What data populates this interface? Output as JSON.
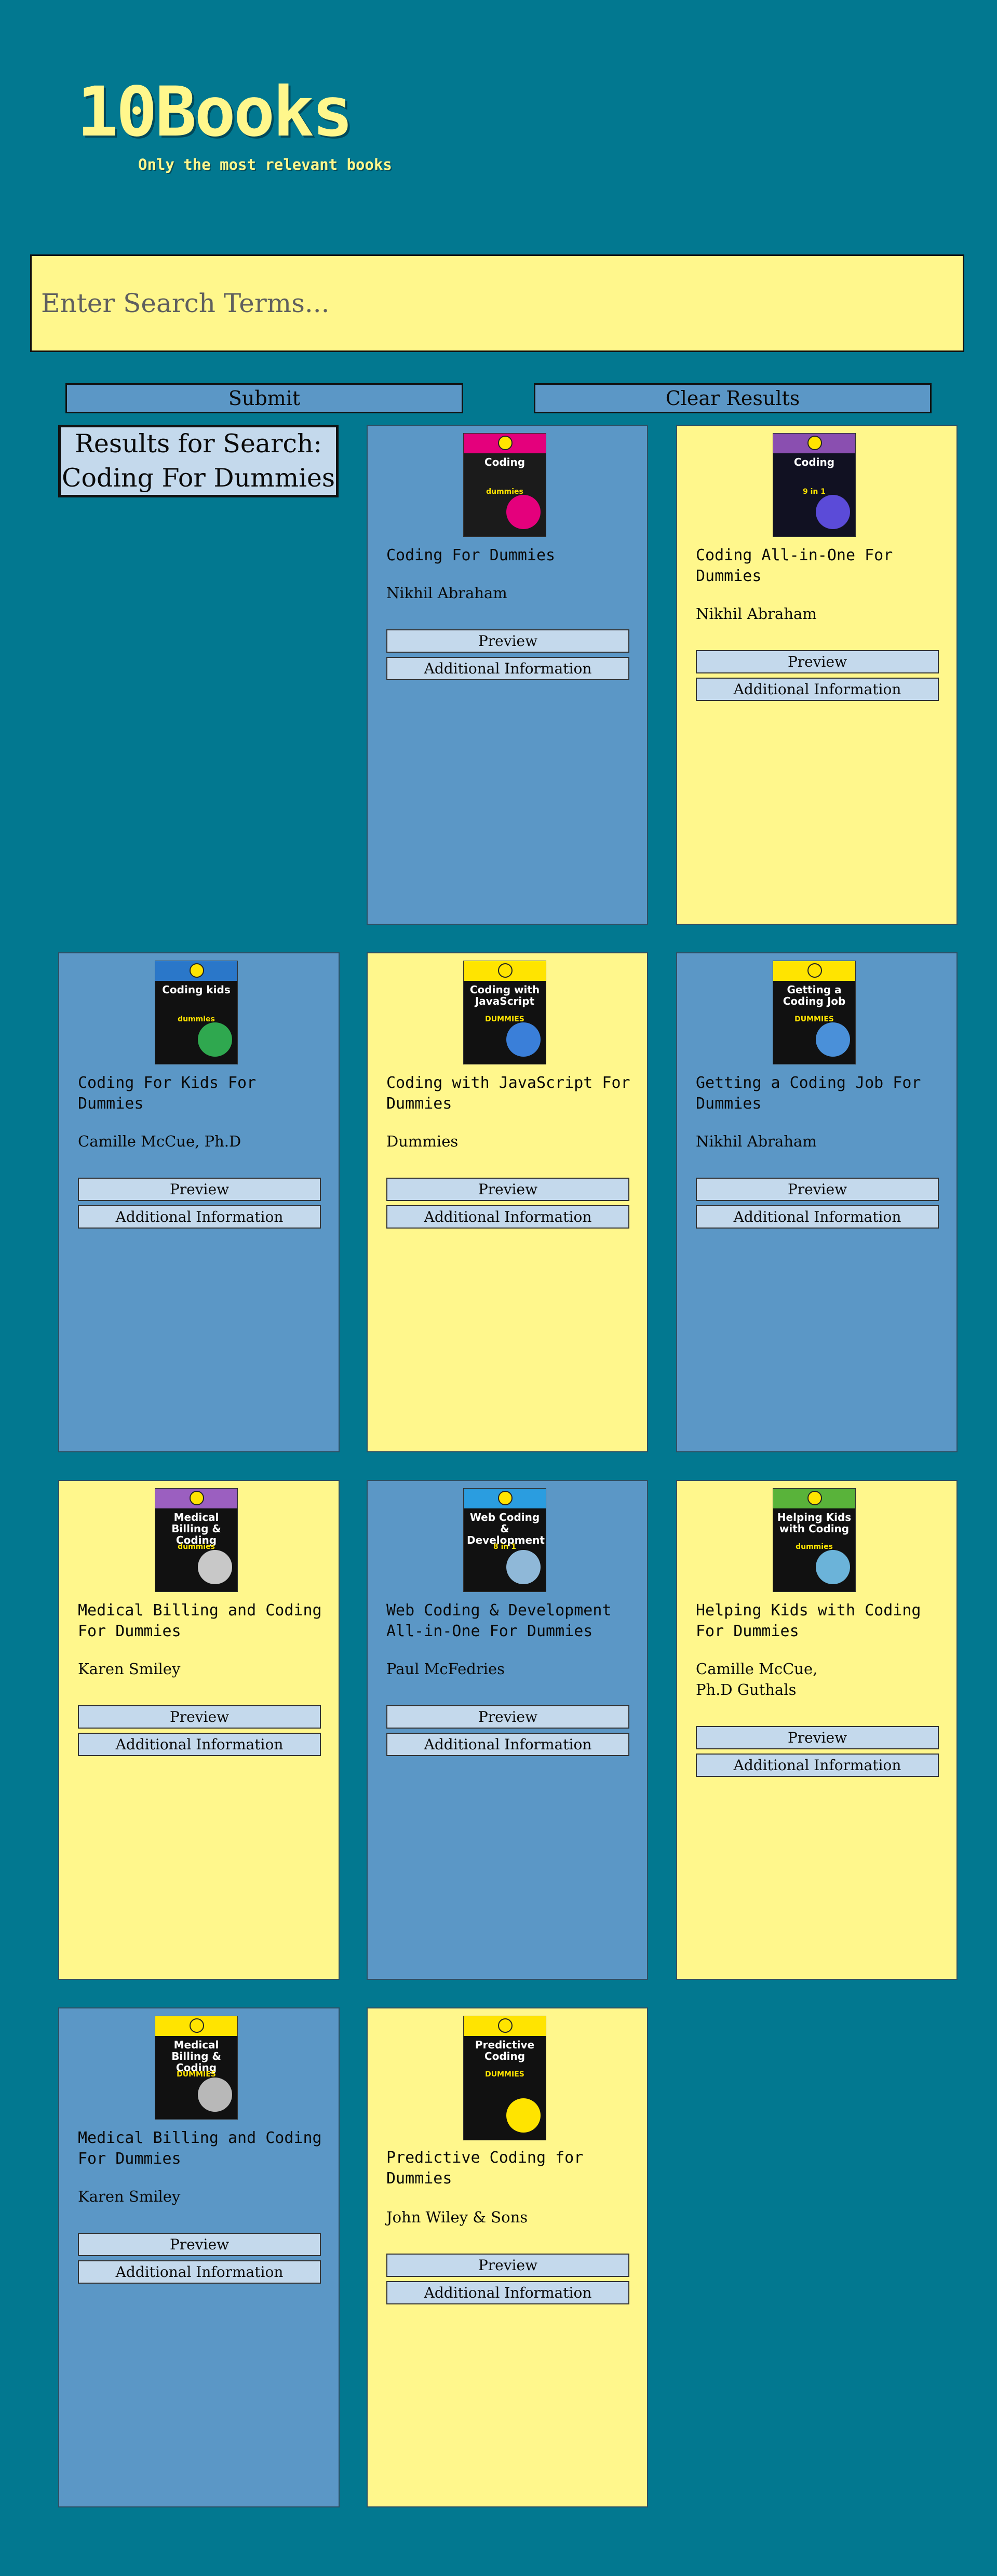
{
  "header": {
    "logo": "10Books",
    "tagline": "Only the most relevant books"
  },
  "search": {
    "placeholder": "Enter Search Terms...",
    "value": "",
    "submit_label": "Submit",
    "clear_label": "Clear Results"
  },
  "results": {
    "heading_line1": "Results for Search:",
    "heading_line2": "Coding For Dummies"
  },
  "colors": {
    "background": "#027890",
    "card_blue": "#5B97C6",
    "card_yellow": "#FFF78C",
    "button_light": "#C4D9EC"
  },
  "books": [
    {
      "title": "Coding For Dummies",
      "author": "Nikhil Abraham",
      "preview_label": "Preview",
      "info_label": "Additional Information"
    },
    {
      "title": "Coding All-in-One For Dummies",
      "author": "Nikhil Abraham",
      "preview_label": "Preview",
      "info_label": "Additional Information"
    },
    {
      "title": "Coding For Kids For Dummies",
      "author": "Camille McCue, Ph.D",
      "preview_label": "Preview",
      "info_label": "Additional Information"
    },
    {
      "title": "Coding with JavaScript For Dummies",
      "author": "Dummies",
      "preview_label": "Preview",
      "info_label": "Additional Information"
    },
    {
      "title": "Getting a Coding Job For Dummies",
      "author": "Nikhil Abraham",
      "preview_label": "Preview",
      "info_label": "Additional Information"
    },
    {
      "title": "Medical Billing and Coding For Dummies",
      "author": "Karen Smiley",
      "preview_label": "Preview",
      "info_label": "Additional Information"
    },
    {
      "title": "Web Coding & Development All-in-One For Dummies",
      "author": "Paul McFedries",
      "preview_label": "Preview",
      "info_label": "Additional Information"
    },
    {
      "title": "Helping Kids with Coding For Dummies",
      "author": "Camille McCue, Ph.D Guthals",
      "preview_label": "Preview",
      "info_label": "Additional Information"
    },
    {
      "title": "Medical Billing and Coding For Dummies",
      "author": "Karen Smiley",
      "preview_label": "Preview",
      "info_label": "Additional Information"
    },
    {
      "title": "Predictive Coding for Dummies",
      "author": "John Wiley & Sons",
      "preview_label": "Preview",
      "info_label": "Additional Information"
    }
  ],
  "covers": [
    {
      "title": "Coding",
      "brand": "dummies",
      "band": "#E4007C",
      "body": "#1b1b1b",
      "art": "#E4007C",
      "icon": "coding-cover-icon"
    },
    {
      "title": "Coding",
      "brand": "9 in 1",
      "band": "#8a4fb0",
      "body": "#111122",
      "art": "#5b4bd8",
      "icon": "coding-all-in-one-cover-icon"
    },
    {
      "title": "Coding kids",
      "brand": "dummies",
      "band": "#2a77c9",
      "body": "#111",
      "art": "#2fa84f",
      "icon": "coding-kids-cover-icon"
    },
    {
      "title": "Coding with JavaScript",
      "brand": "DUMMIES",
      "band": "#FFE400",
      "body": "#111",
      "art": "#3a7fd9",
      "icon": "javascript-cover-icon"
    },
    {
      "title": "Getting a Coding Job",
      "brand": "DUMMIES",
      "band": "#FFE400",
      "body": "#111",
      "art": "#4a90d9",
      "icon": "coding-job-cover-icon"
    },
    {
      "title": "Medical Billing & Coding",
      "brand": "dummies",
      "band": "#9b5fc0",
      "body": "#111",
      "art": "#c8c8c8",
      "icon": "medical-billing-cover-icon"
    },
    {
      "title": "Web Coding & Development",
      "brand": "8 in 1",
      "band": "#2a9de0",
      "body": "#111",
      "art": "#8fb8d8",
      "icon": "web-coding-cover-icon"
    },
    {
      "title": "Helping Kids with Coding",
      "brand": "dummies",
      "band": "#59b33a",
      "body": "#111",
      "art": "#6bb3d9",
      "icon": "helping-kids-cover-icon"
    },
    {
      "title": "Medical Billing & Coding",
      "brand": "DUMMIES",
      "band": "#FFE400",
      "body": "#111",
      "art": "#b8b8b8",
      "icon": "medical-billing-yellow-cover-icon"
    },
    {
      "title": "Predictive Coding",
      "brand": "DUMMIES",
      "band": "#FFE400",
      "body": "#111",
      "art": "#FFE400",
      "icon": "predictive-coding-cover-icon"
    }
  ]
}
